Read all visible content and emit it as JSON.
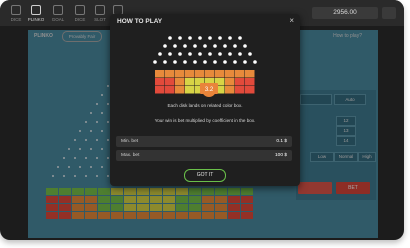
{
  "topbar": {
    "nav": [
      {
        "label": "DICE",
        "icon": "dice-icon"
      },
      {
        "label": "PLINKO",
        "icon": "plinko-icon"
      },
      {
        "label": "GOAL",
        "icon": "goal-icon"
      },
      {
        "label": "DICE",
        "icon": "dice-icon"
      },
      {
        "label": "SLOT",
        "icon": "slot-icon"
      },
      {
        "label": "MINES",
        "icon": "mines-icon"
      }
    ],
    "balance": "2956.00"
  },
  "game": {
    "title": "PLINKO",
    "provably_fair": "Provably Fair",
    "how_to_play": "How to play?",
    "auto": "Auto",
    "opts": [
      "12",
      "13",
      "14",
      "15",
      "16"
    ],
    "risk": [
      "Low",
      "Normal",
      "High"
    ],
    "bet_button": "BET"
  },
  "modal": {
    "title": "HOW TO PLAY",
    "multiplier": "3.2",
    "line1": "Each disk lands on related color box.",
    "line2": "Your win is bet multiplied by coefficient in the box.",
    "min_label": "Min. bet",
    "min_value": "0.1 $",
    "max_label": "Max. bet",
    "max_value": "100 $",
    "got_it": "GOT IT"
  },
  "colors": {
    "green": "#78c24a",
    "yellow": "#d7d446",
    "orange": "#e78a3b",
    "red": "#e24a3b"
  }
}
